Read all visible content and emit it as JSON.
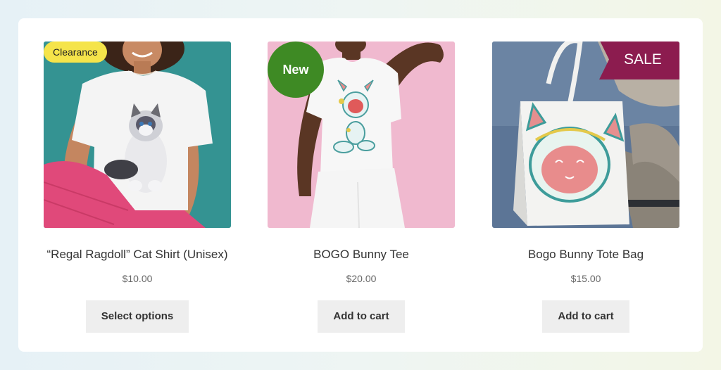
{
  "products": [
    {
      "badge": "Clearance",
      "name": "“Regal Ragdoll” Cat Shirt (Unisex)",
      "price": "$10.00",
      "button": "Select options",
      "image": "woman-in-cat-print-shirt-photo"
    },
    {
      "badge": "New",
      "name": "BOGO Bunny Tee",
      "price": "$20.00",
      "button": "Add to cart",
      "image": "woman-in-bunny-robot-tee-photo"
    },
    {
      "badge": "SALE",
      "name": "Bogo Bunny Tote Bag",
      "price": "$15.00",
      "button": "Add to cart",
      "image": "bunny-tote-bag-photo"
    }
  ],
  "colors": {
    "clearance_badge": "#f5e44a",
    "new_badge": "#3e8a24",
    "sale_badge": "#8c1c4f",
    "button_bg": "#eeeeee"
  }
}
